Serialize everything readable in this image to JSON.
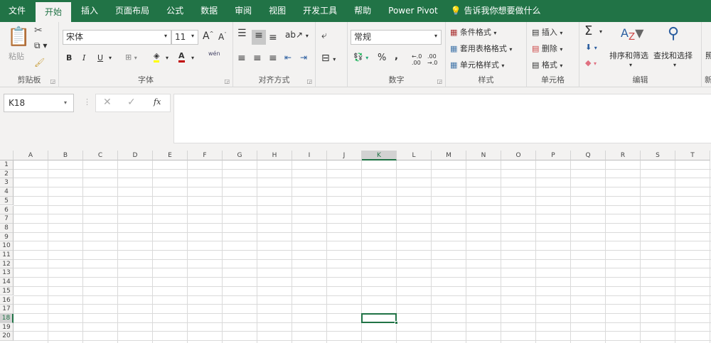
{
  "tabs": [
    "文件",
    "开始",
    "插入",
    "页面布局",
    "公式",
    "数据",
    "审阅",
    "视图",
    "开发工具",
    "帮助",
    "Power Pivot"
  ],
  "active_tab": "开始",
  "tell_me": "告诉我你想要做什么",
  "clipboard": {
    "label": "剪贴板",
    "paste": "粘贴"
  },
  "font": {
    "label": "字体",
    "name": "宋体",
    "size": "11",
    "bold": "B",
    "italic": "I",
    "underline": "U",
    "phonetic": "wén"
  },
  "alignment": {
    "label": "对齐方式"
  },
  "number": {
    "label": "数字",
    "format": "常规",
    "percent": "%",
    "comma": ","
  },
  "styles": {
    "label": "样式",
    "items": [
      "条件格式",
      "套用表格格式",
      "单元格样式"
    ]
  },
  "cells": {
    "label": "单元格",
    "items": [
      "插入",
      "删除",
      "格式"
    ]
  },
  "editing": {
    "label": "编辑",
    "sort": "排序和筛选",
    "find": "查找和选择",
    "sum": "Σ"
  },
  "next_group": {
    "label": "新",
    "item": "照"
  },
  "formula_bar": {
    "name_box": "K18",
    "fx": "fx",
    "value": ""
  },
  "grid": {
    "columns": [
      "A",
      "B",
      "C",
      "D",
      "E",
      "F",
      "G",
      "H",
      "I",
      "J",
      "K",
      "L",
      "M",
      "N",
      "O",
      "P",
      "Q",
      "R",
      "S",
      "T"
    ],
    "rows": [
      "1",
      "2",
      "3",
      "4",
      "5",
      "6",
      "7",
      "8",
      "9",
      "10",
      "11",
      "12",
      "13",
      "14",
      "15",
      "16",
      "17",
      "18",
      "19",
      "20"
    ],
    "selected": "K18"
  },
  "colors": {
    "brand": "#217346",
    "fill": "#ffff00",
    "font": "#c00000"
  }
}
